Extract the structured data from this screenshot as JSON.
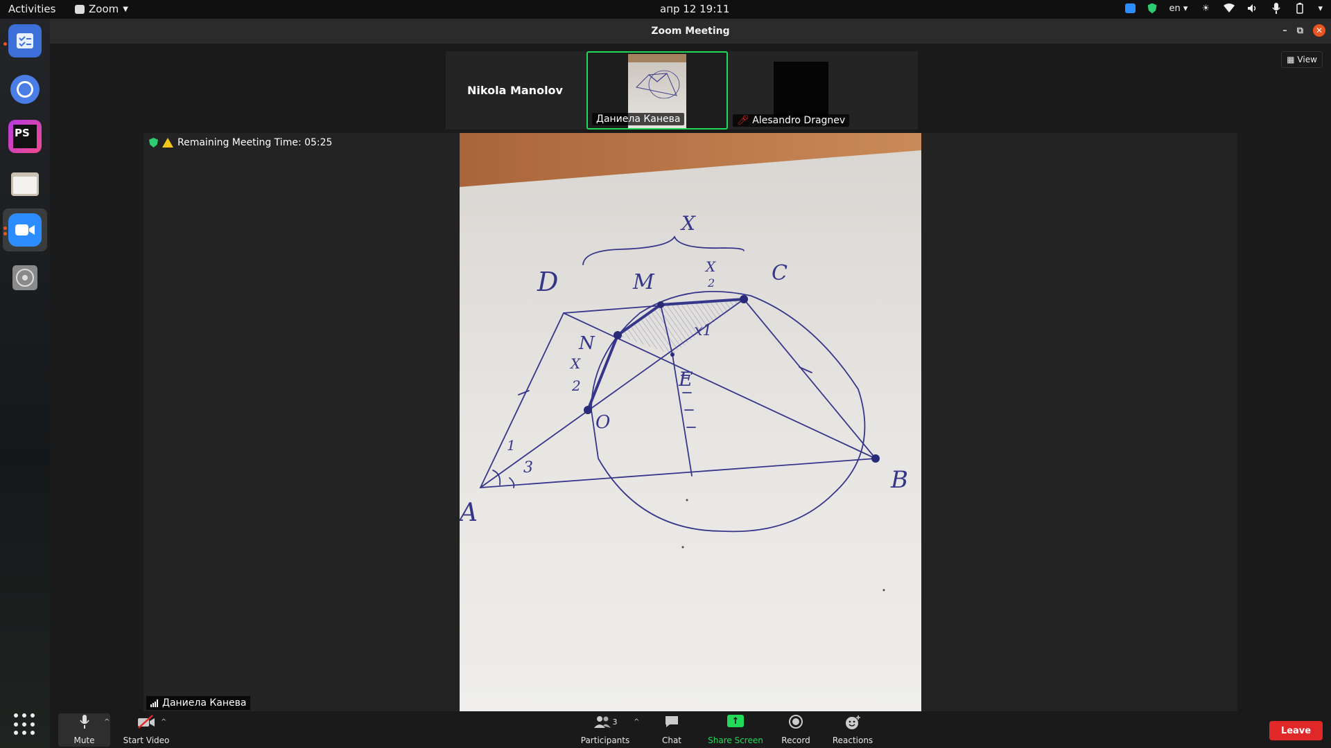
{
  "topbar": {
    "activities": "Activities",
    "app_name": "Zoom",
    "clock": "апр 12  19:11",
    "lang": "en"
  },
  "window": {
    "title": "Zoom Meeting"
  },
  "participants_strip": {
    "nikola": "Nikola Manolov",
    "daniela": "Даниела Канева",
    "alesandro": "Alesandro Dragnev"
  },
  "view_button": "View",
  "meeting": {
    "remaining_time": "Remaining Meeting Time: 05:25",
    "active_speaker": "Даниела Канева"
  },
  "drawing_labels": [
    "X",
    "C",
    "M",
    "D",
    "N",
    "X",
    "2",
    "X",
    "2",
    "E",
    "O",
    "B",
    "A",
    "1",
    "3",
    "x1"
  ],
  "toolbar": {
    "mute": "Mute",
    "start_video": "Start Video",
    "participants": "Participants",
    "participants_count": "3",
    "chat": "Chat",
    "share_screen": "Share Screen",
    "record": "Record",
    "reactions": "Reactions",
    "leave": "Leave"
  },
  "colors": {
    "accent_green": "#23d959",
    "leave_red": "#e02828",
    "zoom_blue": "#2d8cff"
  }
}
